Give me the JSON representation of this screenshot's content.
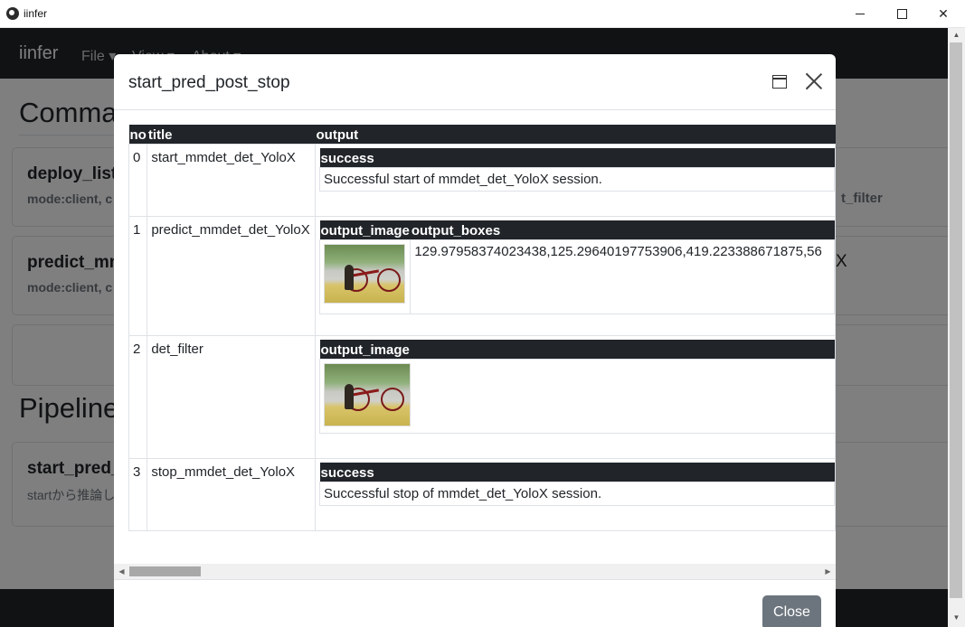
{
  "window": {
    "title": "iinfer"
  },
  "navbar": {
    "brand": "iinfer",
    "menus": [
      "File ▾",
      "View ▾",
      "About ▾"
    ]
  },
  "background": {
    "heading_commands": "Comma",
    "heading_pipelines": "Pipeline",
    "cards": [
      {
        "title": "deploy_list",
        "sub": "mode:client, c"
      },
      {
        "title": "predict_mm",
        "sub": "mode:client, c"
      },
      {
        "title": "start_pred_",
        "sub": "startから推論し"
      }
    ],
    "side_text": "t_filter"
  },
  "modal": {
    "title": "start_pred_post_stop",
    "columns": {
      "no": "no",
      "title": "title",
      "output": "output"
    },
    "rows": [
      {
        "no": "0",
        "title": "start_mmdet_det_YoloX",
        "header": "success",
        "text": "Successful start of mmdet_det_YoloX session."
      },
      {
        "no": "1",
        "title": "predict_mmdet_det_YoloX",
        "header_image": "output_image",
        "header_boxes": "output_boxes",
        "boxes": "129.97958374023438,125.29640197753906,419.223388671875,56"
      },
      {
        "no": "2",
        "title": "det_filter",
        "header_image": "output_image"
      },
      {
        "no": "3",
        "title": "stop_mmdet_det_YoloX",
        "header": "success",
        "text": "Successful stop of mmdet_det_YoloX session."
      }
    ],
    "overflow_char": "X",
    "close_label": "Close"
  }
}
